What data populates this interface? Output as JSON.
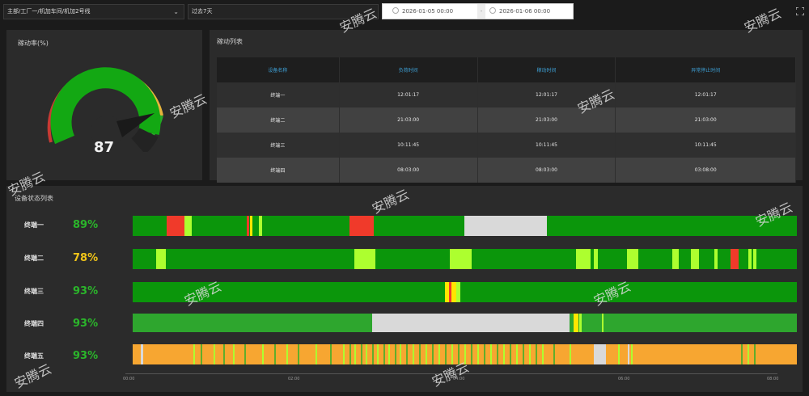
{
  "filters": {
    "line_select": "主部/工厂一/机加车间/机加2号线",
    "time_range": "过去7天",
    "start_time": "2026-01-05 00:00",
    "end_time": "2026-01-06 00:00",
    "separator": "-"
  },
  "gauge": {
    "title": "稼动率(%)",
    "value": 87
  },
  "table": {
    "title": "稼动列表",
    "headers": [
      "设备名称",
      "负荷时间",
      "稼动时间",
      "异常停止时间"
    ],
    "rows": [
      [
        "终端一",
        "12:01:17",
        "12:01:17",
        "12:01:17"
      ],
      [
        "终端二",
        "21:03:00",
        "21:03:00",
        "21:03:00"
      ],
      [
        "终端三",
        "10:11:45",
        "10:11:45",
        "10:11:45"
      ],
      [
        "终端四",
        "08:03:00",
        "08:03:00",
        "03:08:00"
      ]
    ]
  },
  "status": {
    "title": "设备状态列表",
    "rows": [
      {
        "name": "终端一",
        "percent": "89%",
        "percent_color": "#2bb52b",
        "bar_color": "#0b960b"
      },
      {
        "name": "终端二",
        "percent": "78%",
        "percent_color": "#f0c419",
        "bar_color": "#0b960b"
      },
      {
        "name": "终端三",
        "percent": "93%",
        "percent_color": "#2bb52b",
        "bar_color": "#0b960b"
      },
      {
        "name": "终端四",
        "percent": "93%",
        "percent_color": "#2bb52b",
        "bar_color": "#2ea62e"
      },
      {
        "name": "终端五",
        "percent": "93%",
        "percent_color": "#2bb52b",
        "bar_color": "#f7a631"
      }
    ],
    "axis_ticks": [
      "00:00",
      "02:00",
      "04:00",
      "06:00",
      "08:00"
    ]
  },
  "watermark": "安腾云",
  "colors": {
    "running": "#0b960b",
    "idle": "#adff2f",
    "alarm": "#f03a2a",
    "offline": "#d9d9d9",
    "warning": "#ffe600",
    "standby": "#f7a631"
  },
  "icons": {
    "dropdown": "chevron-down-icon",
    "clock": "clock-icon",
    "fullscreen": "fullscreen-icon"
  }
}
